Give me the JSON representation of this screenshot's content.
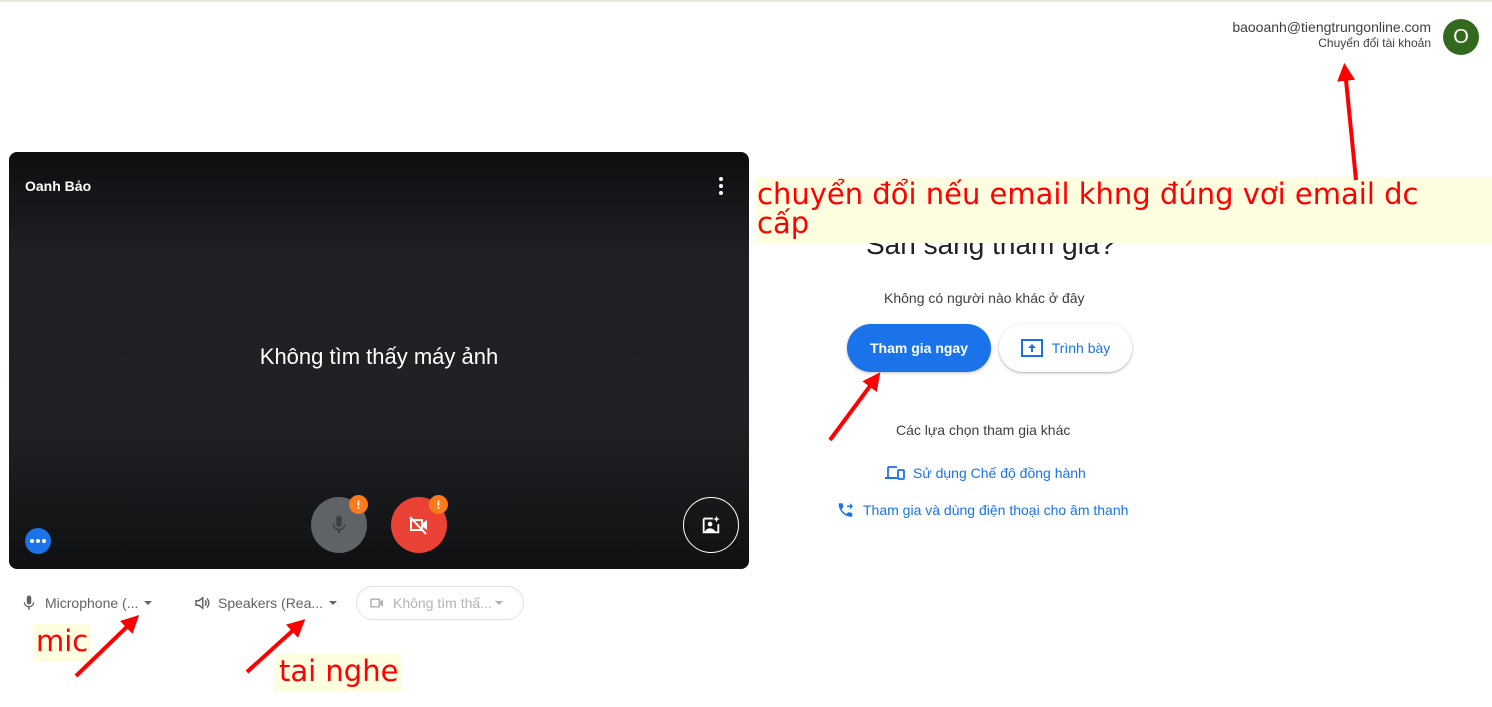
{
  "account": {
    "email": "baooanh@tiengtrungonline.com",
    "switch_label": "Chuyển đổi tài khoản",
    "avatar_initial": "O",
    "avatar_color": "#33691e"
  },
  "preview": {
    "user_name": "Oanh Bảo",
    "no_camera_message": "Không tìm thấy máy ảnh",
    "mic_warning": "!",
    "camera_warning": "!"
  },
  "devices": {
    "microphone": "Microphone (...",
    "speakers": "Speakers (Rea...",
    "camera": "Không tìm thấ..."
  },
  "join": {
    "title": "Sẵn sàng tham gia?",
    "status": "Không có người nào khác ở đây",
    "join_button": "Tham gia ngay",
    "present_button": "Trình bày",
    "other_options_title": "Các lựa chọn tham gia khác",
    "companion_mode": "Sử dụng Chế độ đồng hành",
    "phone_audio": "Tham gia và dùng điện thoại cho âm thanh"
  },
  "annotations": {
    "switch_note": "chuyển đổi nếu email khng đúng vơi email dc cấp",
    "mic_note": "mic",
    "headphone_note": "tai nghe"
  },
  "colors": {
    "primary": "#1a73e8",
    "danger": "#ea4335",
    "warning": "#fa7b17",
    "annotation": "#ff0000"
  }
}
